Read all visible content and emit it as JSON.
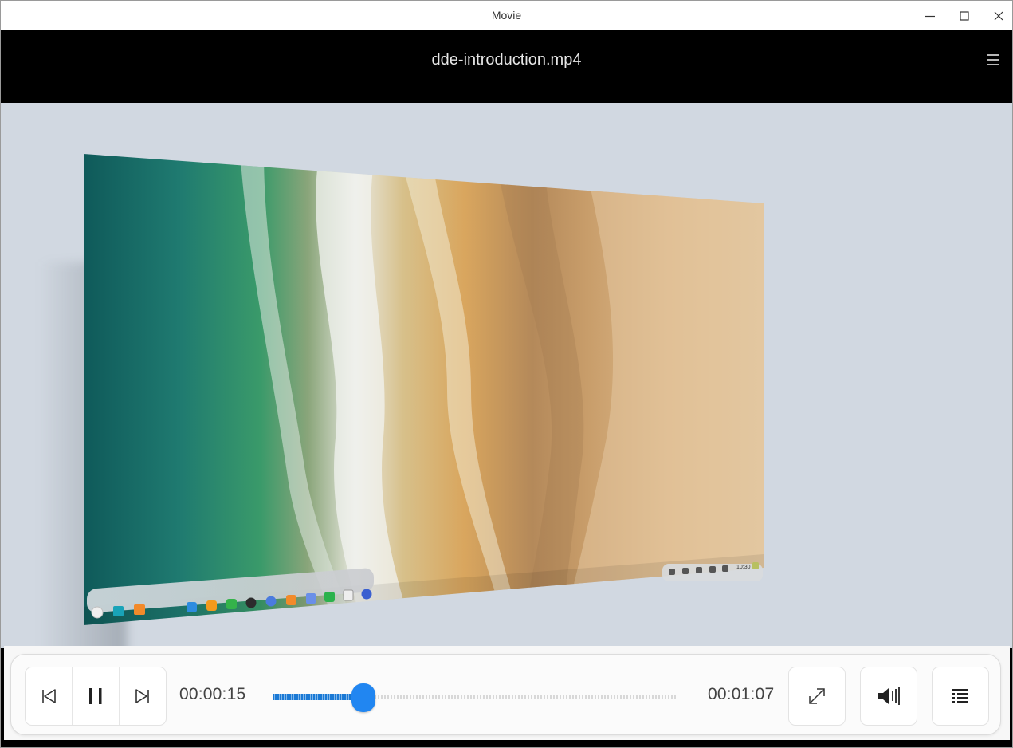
{
  "window": {
    "title": "Movie",
    "controls": {
      "minimize": "minimize-icon",
      "maximize": "maximize-icon",
      "close": "close-icon"
    }
  },
  "header": {
    "filename": "dde-introduction.mp4",
    "menu_icon": "hamburger-menu-icon"
  },
  "player": {
    "current_time": "00:00:15",
    "total_time": "00:01:07",
    "progress_fraction": 0.224,
    "buttons": {
      "previous": "previous-track-icon",
      "play_pause": "pause-icon",
      "next": "next-track-icon",
      "fullscreen": "fullscreen-icon",
      "volume": "volume-icon",
      "playlist": "playlist-icon"
    }
  },
  "video_frame": {
    "clock_text": "10:30"
  },
  "colors": {
    "accent": "#2186f1",
    "header_bg": "#000000",
    "video_bg": "#d1d8e1"
  }
}
